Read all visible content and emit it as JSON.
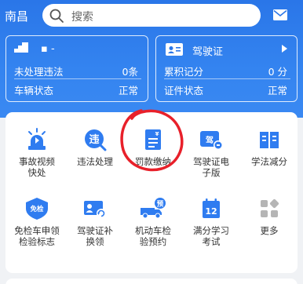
{
  "header": {
    "city": "南昌",
    "search_placeholder": "搜索",
    "icons": [
      "search-icon",
      "mail-icon"
    ]
  },
  "vehicle_card": {
    "plate": "▪ -",
    "rows": [
      {
        "label": "未处理违法",
        "value": "0条"
      },
      {
        "label": "车辆状态",
        "value": "正常"
      }
    ],
    "icon": "car-icon"
  },
  "license_card": {
    "title": "驾驶证",
    "rows": [
      {
        "label": "累积记分",
        "value": "0 分"
      },
      {
        "label": "证件状态",
        "value": "正常"
      }
    ],
    "icon": "id-card-icon"
  },
  "services": [
    {
      "label": "事故视频\n快处",
      "icon": "siren-icon"
    },
    {
      "label": "违法处理",
      "icon": "violation-icon",
      "badge": "违"
    },
    {
      "label": "罚款缴纳",
      "icon": "fine-bill-icon"
    },
    {
      "label": "驾驶证电\n子版",
      "icon": "e-license-icon",
      "badge": "驾"
    },
    {
      "label": "学法减分",
      "icon": "book-icon"
    },
    {
      "label": "免检车申领\n检验标志",
      "icon": "exempt-badge-icon",
      "badge": "免检"
    },
    {
      "label": "驾驶证补\n换领",
      "icon": "license-renew-icon"
    },
    {
      "label": "机动车检\n验预约",
      "icon": "truck-inspection-icon",
      "badge": "预"
    },
    {
      "label": "满分学习\n考试",
      "icon": "calendar-icon",
      "badge": "12"
    },
    {
      "label": "更多",
      "icon": "more-icon"
    }
  ],
  "colors": {
    "primary": "#2a76e8",
    "icon_blue": "#2f7cf0",
    "annotation_red": "#e8202a"
  }
}
